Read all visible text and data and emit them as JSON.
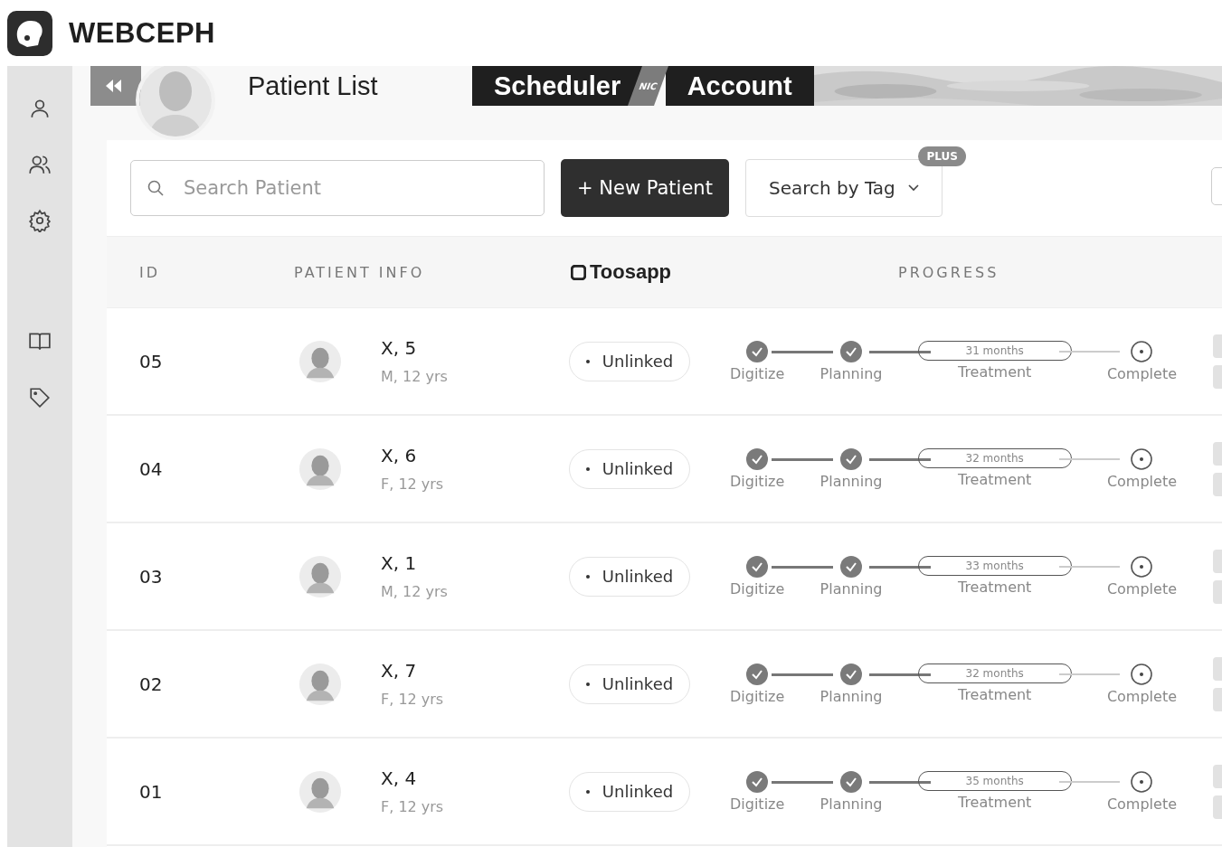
{
  "brand": {
    "name": "WEBCEPH"
  },
  "tabs": [
    {
      "label": "Patient List",
      "selected": true
    },
    {
      "label": "Scheduler",
      "selected": false,
      "ribbon": "NIC"
    },
    {
      "label": "Account",
      "selected": false
    }
  ],
  "toolbar": {
    "search": {
      "placeholder": "Search Patient"
    },
    "new_button": "+ New Patient",
    "tag_filter": {
      "label": "Search by Tag",
      "badge": "PLUS"
    }
  },
  "table": {
    "columns": [
      {
        "kind": "text",
        "label": "ID"
      },
      {
        "kind": "text",
        "label": "PATIENT INFO"
      },
      {
        "kind": "logo",
        "label": "Toosapp"
      },
      {
        "kind": "text",
        "label": "PROGRESS"
      }
    ],
    "rows": [
      {
        "id": "05",
        "name": "X, 5",
        "details": "M, 12 yrs",
        "link": "Unlinked",
        "steps": [
          {
            "label": "Digitize",
            "kind": "done"
          },
          {
            "label": "Planning",
            "kind": "done"
          },
          {
            "label": "Treatment",
            "kind": "current",
            "duration": "31 months"
          },
          {
            "label": "Complete",
            "kind": "pending"
          }
        ]
      },
      {
        "id": "04",
        "name": "X, 6",
        "details": "F, 12 yrs",
        "link": "Unlinked",
        "steps": [
          {
            "label": "Digitize",
            "kind": "done"
          },
          {
            "label": "Planning",
            "kind": "done"
          },
          {
            "label": "Treatment",
            "kind": "current",
            "duration": "32 months"
          },
          {
            "label": "Complete",
            "kind": "pending"
          }
        ]
      },
      {
        "id": "03",
        "name": "X, 1",
        "details": "M, 12 yrs",
        "link": "Unlinked",
        "steps": [
          {
            "label": "Digitize",
            "kind": "done"
          },
          {
            "label": "Planning",
            "kind": "done"
          },
          {
            "label": "Treatment",
            "kind": "current",
            "duration": "33 months"
          },
          {
            "label": "Complete",
            "kind": "pending"
          }
        ]
      },
      {
        "id": "02",
        "name": "X, 7",
        "details": "F, 12 yrs",
        "link": "Unlinked",
        "steps": [
          {
            "label": "Digitize",
            "kind": "done"
          },
          {
            "label": "Planning",
            "kind": "done"
          },
          {
            "label": "Treatment",
            "kind": "current",
            "duration": "32 months"
          },
          {
            "label": "Complete",
            "kind": "pending"
          }
        ]
      },
      {
        "id": "01",
        "name": "X, 4",
        "details": "F, 12 yrs",
        "link": "Unlinked",
        "steps": [
          {
            "label": "Digitize",
            "kind": "done"
          },
          {
            "label": "Planning",
            "kind": "done"
          },
          {
            "label": "Treatment",
            "kind": "current",
            "duration": "35 months"
          },
          {
            "label": "Complete",
            "kind": "pending"
          }
        ]
      }
    ]
  }
}
